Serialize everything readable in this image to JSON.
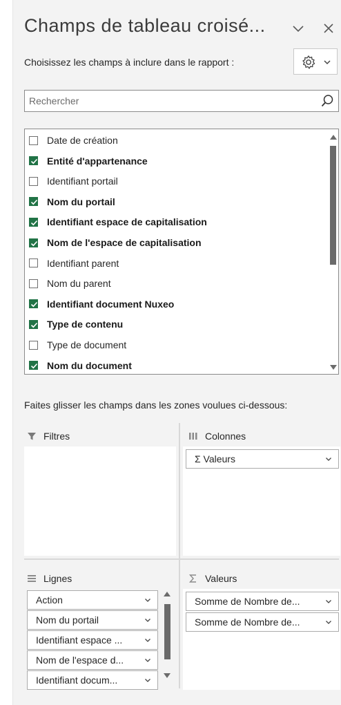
{
  "header": {
    "title": "Champs de tableau croisé...",
    "subtitle": "Choisissez les champs à inclure dans le rapport :"
  },
  "search": {
    "placeholder": "Rechercher"
  },
  "fields": [
    {
      "label": "Date de création",
      "checked": false
    },
    {
      "label": "Entité d'appartenance",
      "checked": true
    },
    {
      "label": "Identifiant portail",
      "checked": false
    },
    {
      "label": "Nom du portail",
      "checked": true
    },
    {
      "label": "Identifiant espace de capitalisation",
      "checked": true
    },
    {
      "label": "Nom de l'espace de capitalisation",
      "checked": true
    },
    {
      "label": "Identifiant parent",
      "checked": false
    },
    {
      "label": "Nom du parent",
      "checked": false
    },
    {
      "label": "Identifiant document Nuxeo",
      "checked": true
    },
    {
      "label": "Type de contenu",
      "checked": true
    },
    {
      "label": "Type de document",
      "checked": false
    },
    {
      "label": "Nom du document",
      "checked": true
    }
  ],
  "areas": {
    "hint": "Faites glisser les champs dans les zones voulues ci-dessous:",
    "filters": {
      "label": "Filtres",
      "items": []
    },
    "columns": {
      "label": "Colonnes",
      "items": [
        "Σ  Valeurs"
      ]
    },
    "rows": {
      "label": "Lignes",
      "items": [
        "Action",
        "Nom du portail",
        "Identifiant espace ...",
        "Nom de l'espace d...",
        "Identifiant docum..."
      ]
    },
    "values": {
      "label": "Valeurs",
      "items": [
        "Somme de Nombre de...",
        "Somme de Nombre de..."
      ]
    }
  },
  "colors": {
    "accent": "#217346",
    "pane_bg": "#f3f3f3"
  },
  "icons": {
    "collapse": "chevron-down-icon",
    "close": "close-icon",
    "settings": "gear-icon",
    "search": "search-icon",
    "filters": "filter-icon",
    "columns": "columns-icon",
    "rows": "rows-icon",
    "values": "sigma-icon"
  }
}
